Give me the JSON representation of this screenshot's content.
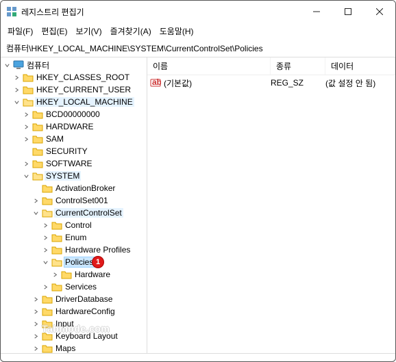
{
  "window": {
    "title": "레지스트리 편집기"
  },
  "menu": {
    "file": "파일(F)",
    "edit": "편집(E)",
    "view": "보기(V)",
    "favorites": "즐겨찾기(A)",
    "help": "도움말(H)"
  },
  "path": "컴퓨터\\HKEY_LOCAL_MACHINE\\SYSTEM\\CurrentControlSet\\Policies",
  "tree": {
    "root": "컴퓨터",
    "hkcr": "HKEY_CLASSES_ROOT",
    "hkcu": "HKEY_CURRENT_USER",
    "hklm": "HKEY_LOCAL_MACHINE",
    "bcd": "BCD00000000",
    "hardware": "HARDWARE",
    "sam": "SAM",
    "security": "SECURITY",
    "software": "SOFTWARE",
    "system": "SYSTEM",
    "activationbroker": "ActivationBroker",
    "controlset001": "ControlSet001",
    "currentcontrolset": "CurrentControlSet",
    "control": "Control",
    "enum": "Enum",
    "hardwareprofiles": "Hardware Profiles",
    "policies": "Policies",
    "policies_hardware": "Hardware",
    "services": "Services",
    "driverdatabase": "DriverDatabase",
    "hardwareconfig": "HardwareConfig",
    "input": "Input",
    "keyboardlayout": "Keyboard Layout",
    "maps": "Maps",
    "badge": "1"
  },
  "list": {
    "cols": {
      "name": "이름",
      "type": "종류",
      "data": "데이터"
    },
    "rows": [
      {
        "name": "(기본값)",
        "type": "REG_SZ",
        "data": "(값 설정 안 됨)"
      }
    ]
  },
  "watermark": "Tabmode.com"
}
